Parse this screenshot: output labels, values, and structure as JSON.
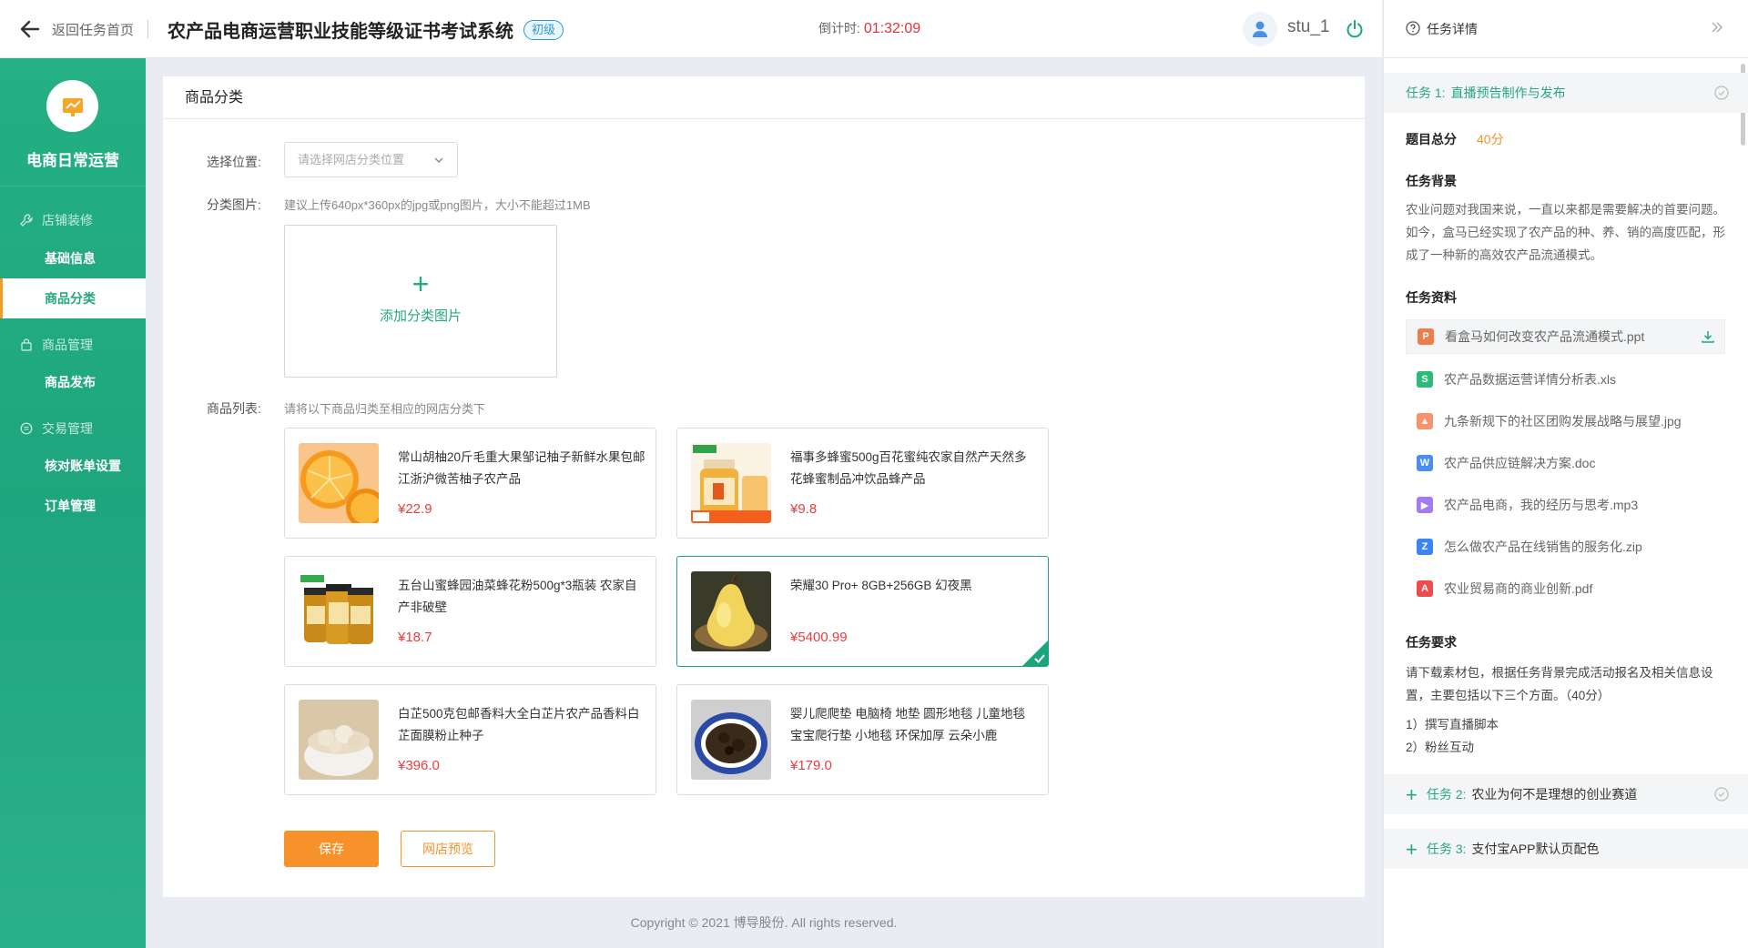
{
  "topbar": {
    "back_label": "返回任务首页",
    "title": "农产品电商运营职业技能等级证书考试系统",
    "level": "初级",
    "countdown_label": "倒计时:",
    "countdown_value": "01:32:09",
    "username": "stu_1"
  },
  "sidebar": {
    "app_name": "电商日常运营",
    "groups": [
      {
        "label": "店铺装修",
        "items": [
          "基础信息",
          "商品分类"
        ]
      },
      {
        "label": "商品管理",
        "items": [
          "商品发布"
        ]
      },
      {
        "label": "交易管理",
        "items": [
          "核对账单设置",
          "订单管理"
        ]
      }
    ],
    "active_item": "商品分类"
  },
  "main": {
    "heading": "商品分类",
    "position_label": "选择位置:",
    "position_placeholder": "请选择网店分类位置",
    "image_label": "分类图片:",
    "image_hint": "建议上传640px*360px的jpg或png图片，大小不能超过1MB",
    "upload_plus": "+",
    "upload_text": "添加分类图片",
    "list_label": "商品列表:",
    "list_hint": "请将以下商品归类至相应的网店分类下",
    "products": [
      {
        "name": "常山胡柚20斤毛重大果邹记柚子新鲜水果包邮江浙沪微苦柚子农产品",
        "price": "¥22.9",
        "selected": false
      },
      {
        "name": "福事多蜂蜜500g百花蜜纯农家自然产天然多花蜂蜜制品冲饮品蜂产品",
        "price": "¥9.8",
        "selected": false
      },
      {
        "name": "五台山蜜蜂园油菜蜂花粉500g*3瓶装 农家自产非破壁",
        "price": "¥18.7",
        "selected": false
      },
      {
        "name": "荣耀30 Pro+ 8GB+256GB 幻夜黑",
        "price": "¥5400.99",
        "selected": true
      },
      {
        "name": "白芷500克包邮香料大全白芷片农产品香料白芷面膜粉止种子",
        "price": "¥396.0",
        "selected": false
      },
      {
        "name": "婴儿爬爬垫 电脑椅 地垫 圆形地毯 儿童地毯 宝宝爬行垫 小地毯 环保加厚 云朵小鹿",
        "price": "¥179.0",
        "selected": false
      }
    ],
    "save_label": "保存",
    "preview_label": "网店预览"
  },
  "footer": {
    "copyright": "Copyright © 2021 博导股份. All rights reserved."
  },
  "right_panel": {
    "title": "任务详情",
    "task1": {
      "num": "任务 1:",
      "title": "直播预告制作与发布"
    },
    "score_label": "题目总分",
    "score_value": "40分",
    "background_label": "任务背景",
    "background_text": "农业问题对我国来说，一直以来都是需要解决的首要问题。如今，盒马已经实现了农产品的种、养、销的高度匹配，形成了一种新的高效农产品流通模式。",
    "materials_label": "任务资料",
    "files": [
      {
        "name": "看盒马如何改变农产品流通模式.ppt",
        "icon": "ppt-icon",
        "color": "#f07c4a"
      },
      {
        "name": "农产品数据运营详情分析表.xls",
        "icon": "xls-icon",
        "color": "#2dbb7a"
      },
      {
        "name": "九条新规下的社区团购发展战略与展望.jpg",
        "icon": "image-icon",
        "color": "#f5946c"
      },
      {
        "name": "农产品供应链解决方案.doc",
        "icon": "doc-icon",
        "color": "#4a8ff0"
      },
      {
        "name": "农产品电商，我的经历与思考.mp3",
        "icon": "audio-icon",
        "color": "#a57af0"
      },
      {
        "name": "怎么做农产品在线销售的服务化.zip",
        "icon": "zip-icon",
        "color": "#3a86f0"
      },
      {
        "name": "农业贸易商的商业创新.pdf",
        "icon": "pdf-icon",
        "color": "#ee4c4c"
      }
    ],
    "requirements_label": "任务要求",
    "requirements_text": "请下载素材包，根据任务背景完成活动报名及相关信息设置，主要包括以下三个方面。（40分）",
    "req_items": [
      "1）撰写直播脚本",
      "2）粉丝互动"
    ],
    "task2": {
      "num": "任务 2:",
      "title": "农业为何不是理想的创业赛道"
    },
    "task3": {
      "num": "任务 3:",
      "title": "支付宝APP默认页配色"
    }
  }
}
